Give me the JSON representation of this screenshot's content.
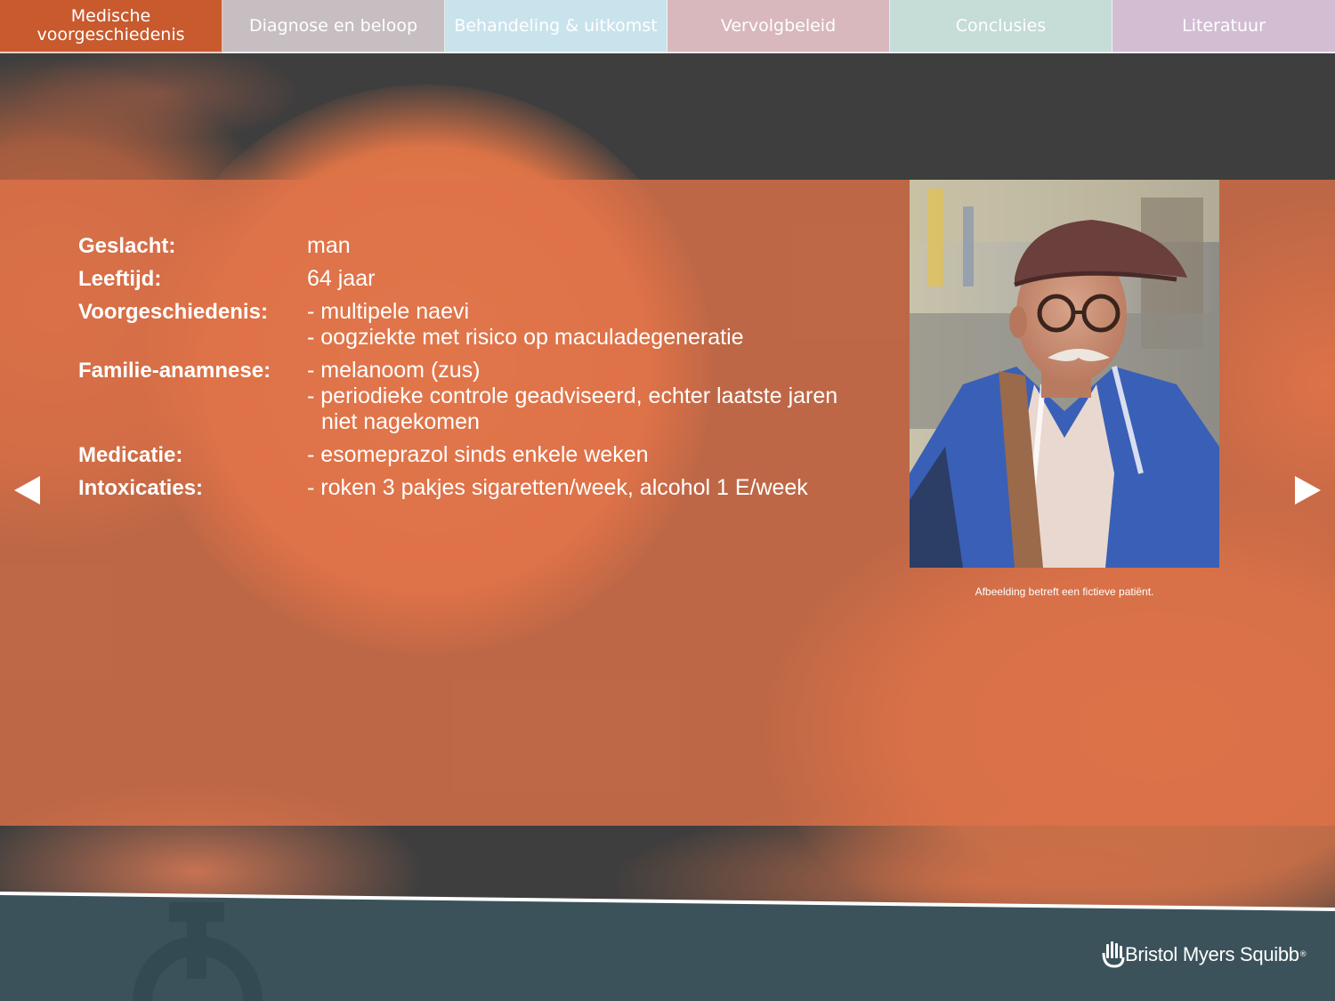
{
  "tabs": [
    {
      "label_line1": "Medische",
      "label_line2": "voorgeschiedenis",
      "active": true
    },
    {
      "label": "Diagnose en beloop"
    },
    {
      "label": "Behandeling & uitkomst"
    },
    {
      "label": "Vervolgbeleid"
    },
    {
      "label": "Conclusies"
    },
    {
      "label": "Literatuur"
    }
  ],
  "patient": {
    "gender": {
      "label": "Geslacht:",
      "value": "man"
    },
    "age": {
      "label": "Leeftijd:",
      "value": "64 jaar"
    },
    "history": {
      "label": "Voorgeschiedenis:",
      "items": [
        "- multipele naevi",
        "- oogziekte met risico op maculadegeneratie"
      ]
    },
    "family": {
      "label": "Familie-anamnese:",
      "items": [
        "- melanoom (zus)",
        "- periodieke controle geadviseerd, echter laatste jaren",
        "niet nagekomen"
      ]
    },
    "medication": {
      "label": "Medicatie:",
      "value": "- esomeprazol sinds enkele weken"
    },
    "intoxications": {
      "label": "Intoxicaties:",
      "value": "- roken 3 pakjes sigaretten/week, alcohol 1 E/week"
    }
  },
  "photo_caption": "Afbeelding betreft een fictieve patiënt.",
  "footer": {
    "brand": "Bristol Myers Squibb",
    "brand_mark": "®"
  },
  "colors": {
    "tab_active": "#c85a2e",
    "panel": "#de7248",
    "footer": "#3b525a",
    "background": "#3e3e3e"
  }
}
